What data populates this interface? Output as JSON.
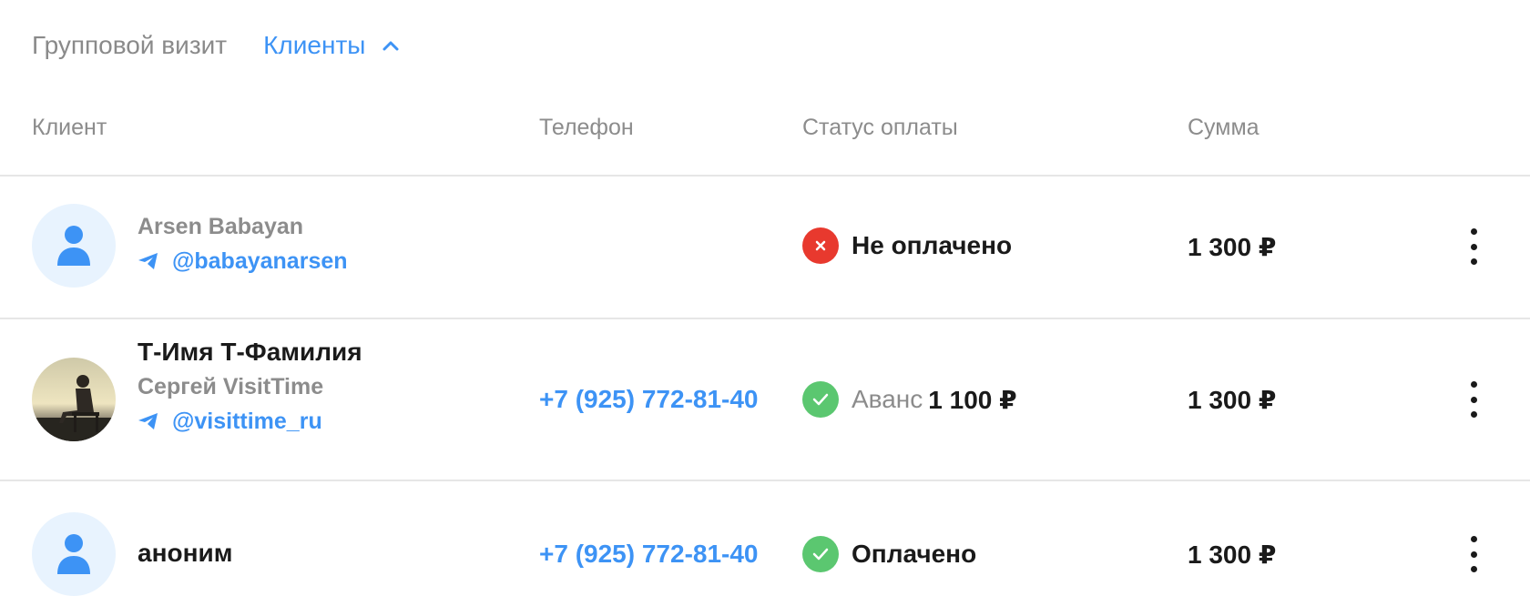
{
  "tabs": {
    "group_visit": "Групповой визит",
    "clients": "Клиенты"
  },
  "table": {
    "columns": [
      "Клиент",
      "Телефон",
      "Статус оплаты",
      "Сумма"
    ],
    "rows": [
      {
        "avatar": "person-placeholder-icon",
        "name": "Arsen  Babayan",
        "telegram": "@babayanarsen",
        "phone": "",
        "status": {
          "type": "unpaid",
          "icon": "cross-icon",
          "color": "#e8392e",
          "label": "Не оплачено"
        },
        "amount": "1 300 ₽"
      },
      {
        "avatar": "photo",
        "display_name": "Т-Имя  Т-Фамилия",
        "name": "Сергей  VisitTime",
        "telegram": "@visittime_ru",
        "phone": "+7 (925) 772-81-40",
        "status": {
          "type": "advance",
          "icon": "check-icon",
          "color": "#5bc770",
          "prefix": "Аванс",
          "label": "1 100 ₽"
        },
        "amount": "1 300 ₽"
      },
      {
        "avatar": "person-placeholder-icon",
        "display_name": "аноним",
        "phone": "+7 (925) 772-81-40",
        "status": {
          "type": "paid",
          "icon": "check-icon",
          "color": "#5bc770",
          "label": "Оплачено"
        },
        "amount": "1 300 ₽"
      }
    ]
  },
  "colors": {
    "accent": "#3d93f5",
    "muted_text": "#8c8c8c",
    "divider": "#e6e6e6",
    "avatar_bg": "#e8f3fe"
  }
}
